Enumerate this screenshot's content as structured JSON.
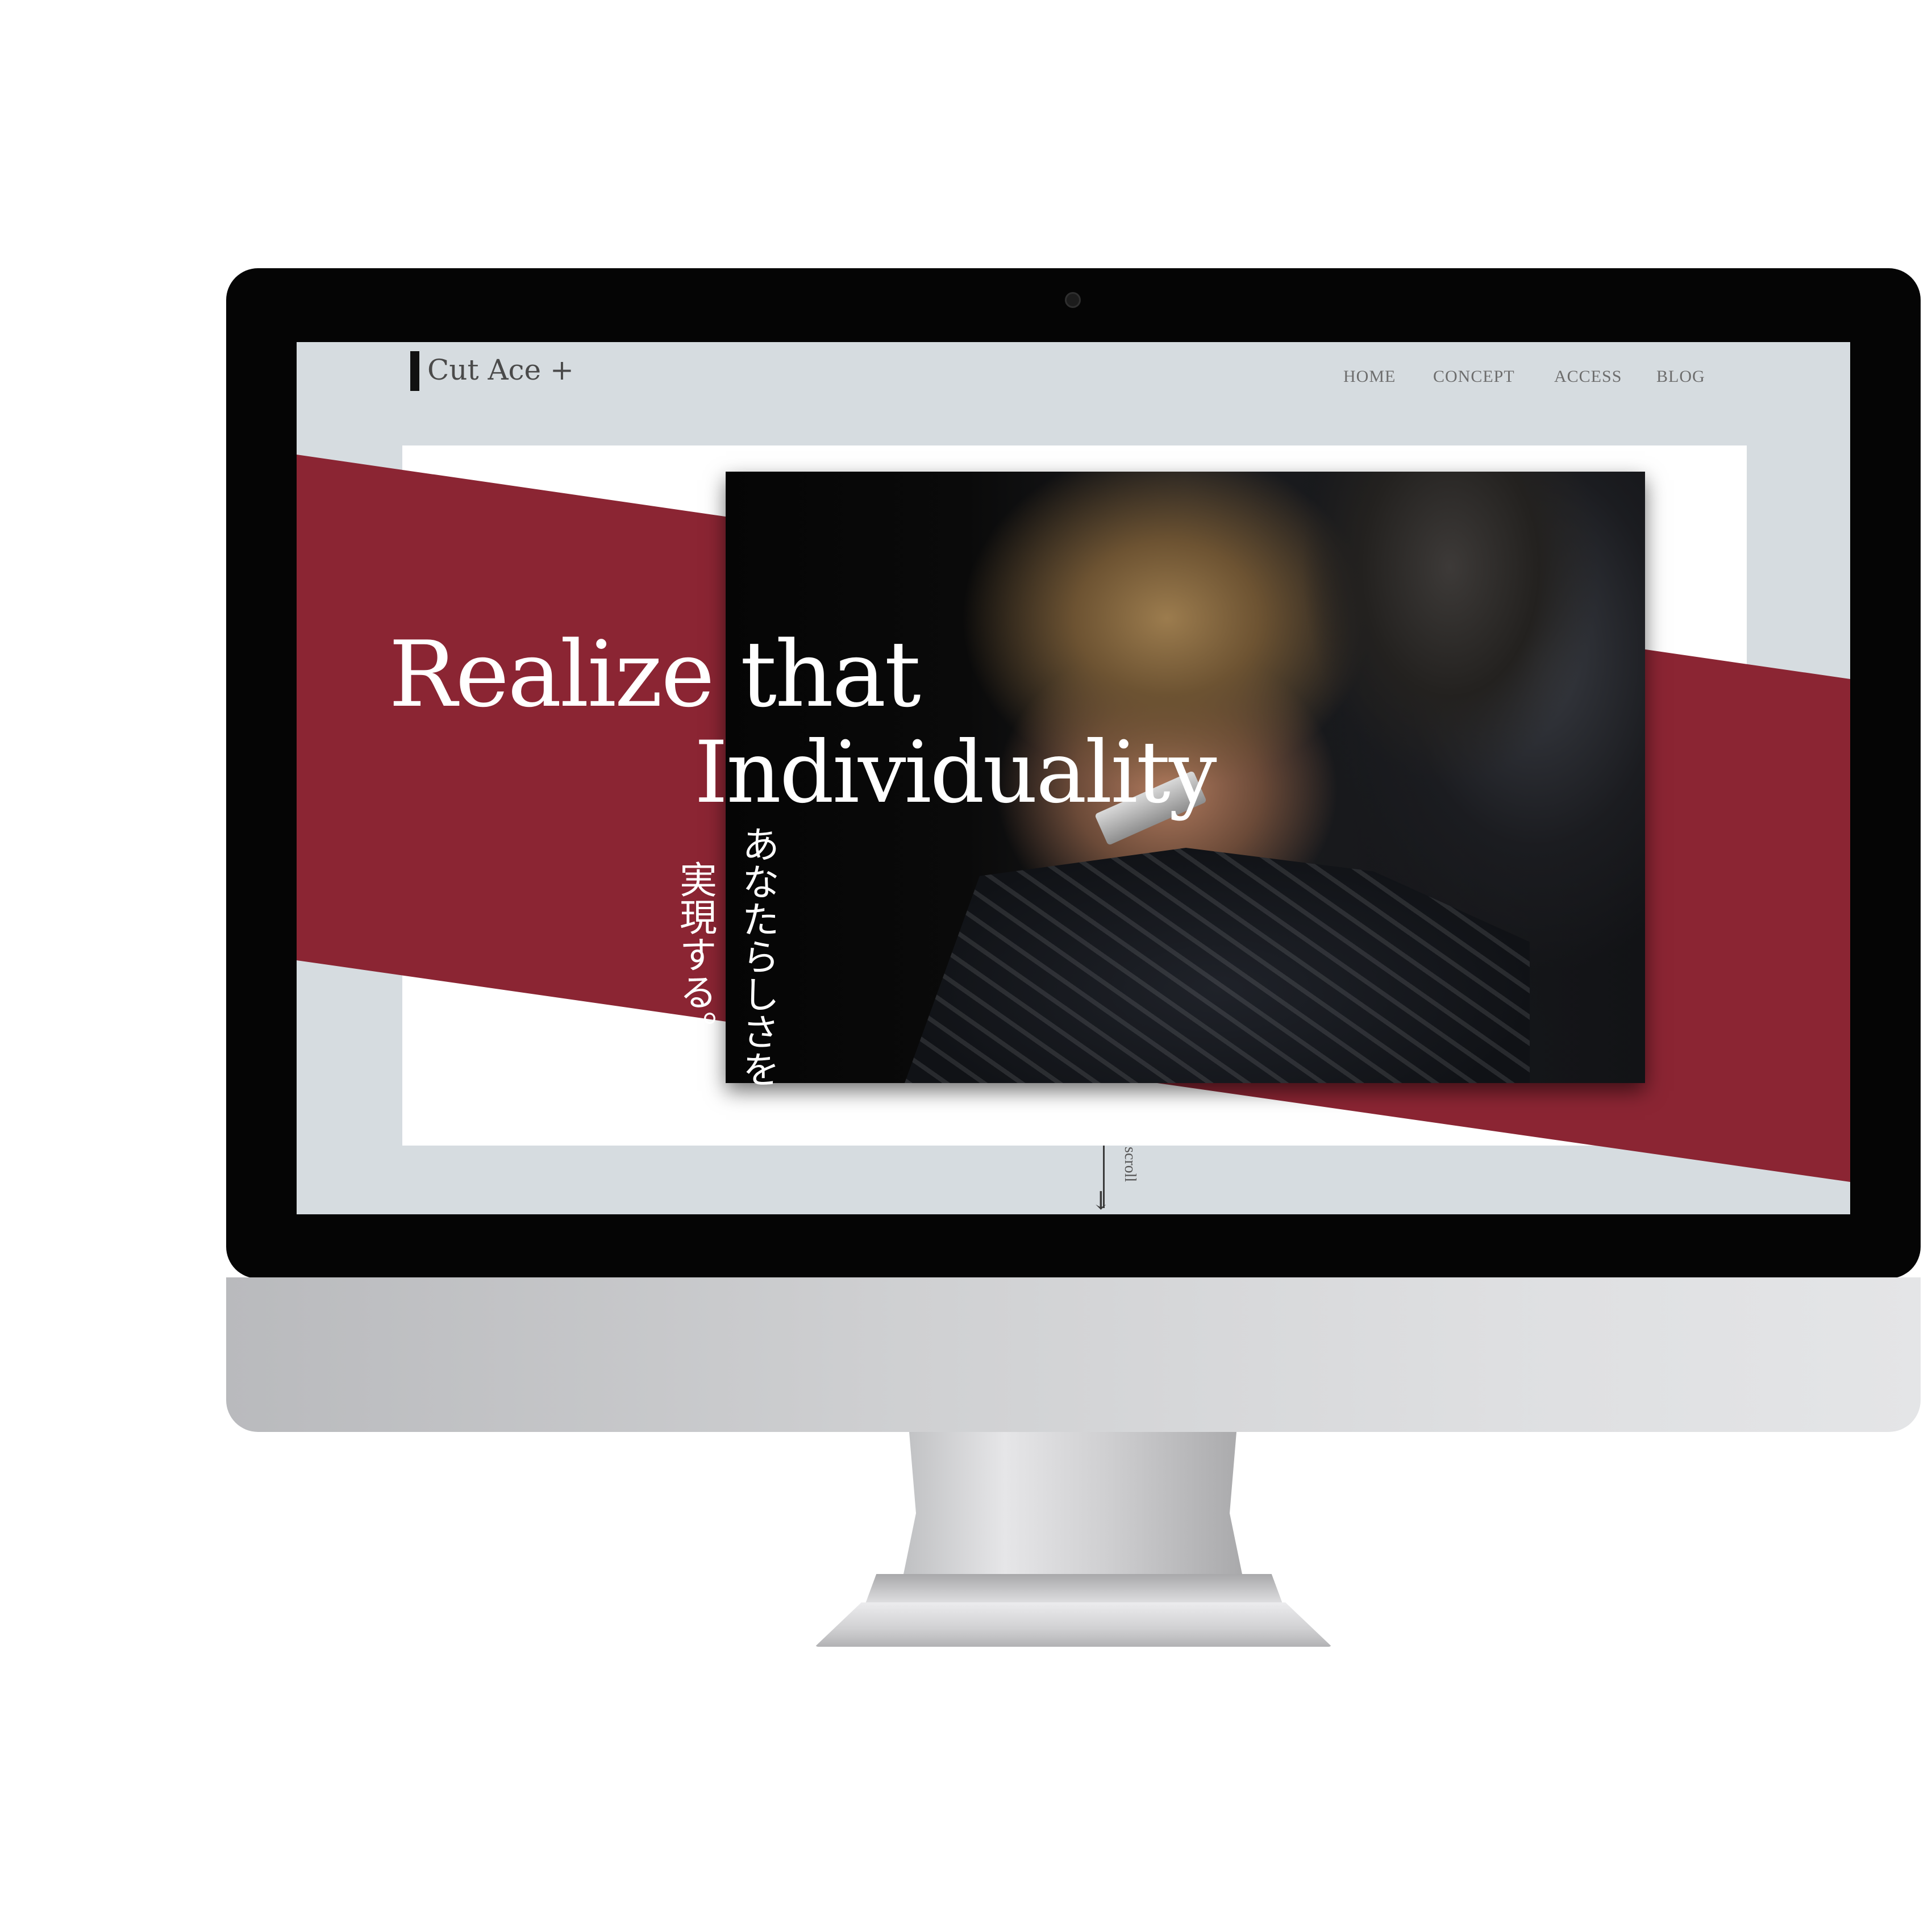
{
  "site": {
    "logo": "Cut Ace +",
    "nav": [
      {
        "label": "HOME"
      },
      {
        "label": "CONCEPT"
      },
      {
        "label": "ACCESS"
      },
      {
        "label": "BLOG"
      }
    ]
  },
  "hero": {
    "headline_line1": "Realize that",
    "headline_line2": "Individuality",
    "jp_line1": "あなたらしさを",
    "jp_line2": "実現する。",
    "image": "barber-photo",
    "accent_color": "#8b2533",
    "background_color": "#d6dce0"
  },
  "scroll": {
    "label": "scroll"
  }
}
